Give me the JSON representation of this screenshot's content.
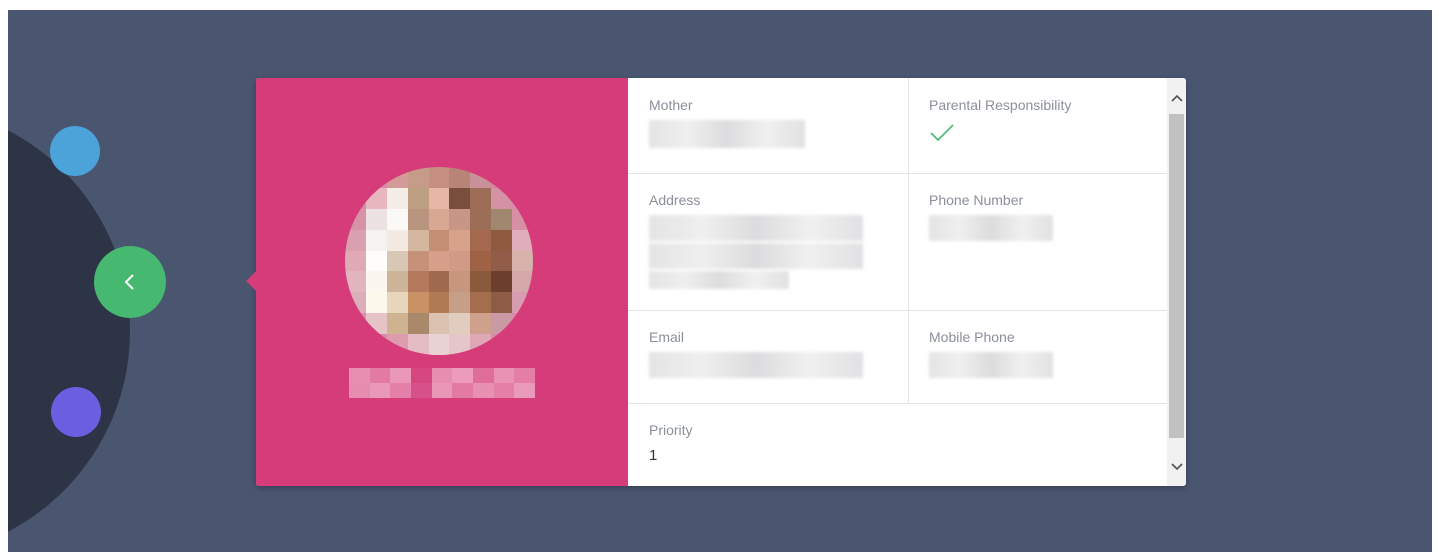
{
  "nav": {
    "back_icon": "chevron-left-icon"
  },
  "colors": {
    "stage_background": "#4a5570",
    "radial_background": "#2d3446",
    "profile_panel": "#d63b7a",
    "back_button": "#47b86f",
    "blue_dot": "#4ba3d9",
    "purple_dot": "#6b5ee0",
    "check": "#47b86f"
  },
  "profile": {
    "avatar_pixels": [
      "#d98aa8",
      "#d88aa6",
      "#d39a98",
      "#c69b87",
      "#c78f81",
      "#b98478",
      "#c9909a",
      "#d6839f",
      "#d78ba7",
      "#d88aa6",
      "#e7b6bf",
      "#f3ede6",
      "#bda081",
      "#e6b7a4",
      "#7a4e3c",
      "#9e6d57",
      "#d393a4",
      "#d98aa8",
      "#d892a8",
      "#ece2e4",
      "#fbf9f5",
      "#b9957f",
      "#d8a892",
      "#c79684",
      "#9c6e58",
      "#a1876f",
      "#d68fa5",
      "#dba0b0",
      "#f6f2f2",
      "#f3ebe3",
      "#d4b79e",
      "#c48e72",
      "#d6a28c",
      "#a4694f",
      "#8e5a40",
      "#dfaeba",
      "#e0a9b6",
      "#fffdfb",
      "#d8c7b4",
      "#c59179",
      "#d8a08a",
      "#cf9a86",
      "#9f6244",
      "#925d48",
      "#d6b2ab",
      "#e2b4bf",
      "#fbf7f0",
      "#cdb59a",
      "#b57a5e",
      "#a06a4e",
      "#c8967e",
      "#8a5a3c",
      "#6c3e2c",
      "#d4a7a9",
      "#dcaeb9",
      "#fdf8ec",
      "#e7d6bd",
      "#c89264",
      "#b07a55",
      "#c6a086",
      "#a46d4d",
      "#8e5c44",
      "#d79caf",
      "#d98ca8",
      "#e5c3c6",
      "#cdb38f",
      "#a9896a",
      "#dbc2b0",
      "#e1cdbf",
      "#cfa18d",
      "#c99aa4",
      "#d98aa8",
      "#d78aa6",
      "#d98aa8",
      "#dc9cae",
      "#e3bcc4",
      "#e8d2d3",
      "#e4c6cb",
      "#dfa8b6",
      "#d98aa8",
      "#d78aa6"
    ],
    "name_pixels": [
      "#e88fb1",
      "#e27aa4",
      "#eb97b8",
      "#d6477f",
      "#e78db0",
      "#ec9bbd",
      "#df6c99",
      "#ea92b4",
      "#e47ea7",
      "#e68cae",
      "#ea98b9",
      "#e47fa7",
      "#d8508a",
      "#ea96b7",
      "#e27aa3",
      "#e98fb2",
      "#e57fa8",
      "#e999ba"
    ]
  },
  "details": {
    "mother": {
      "label": "Mother"
    },
    "parental_responsibility": {
      "label": "Parental Responsibility",
      "value": true,
      "icon": "check-icon"
    },
    "address": {
      "label": "Address"
    },
    "phone_number": {
      "label": "Phone Number"
    },
    "email": {
      "label": "Email"
    },
    "mobile_phone": {
      "label": "Mobile Phone"
    },
    "priority": {
      "label": "Priority",
      "value": "1"
    }
  },
  "scrollbar": {
    "up_icon": "chevron-up-icon",
    "down_icon": "chevron-down-icon",
    "scroll_position": 0.0,
    "visible_fraction": 0.82
  }
}
